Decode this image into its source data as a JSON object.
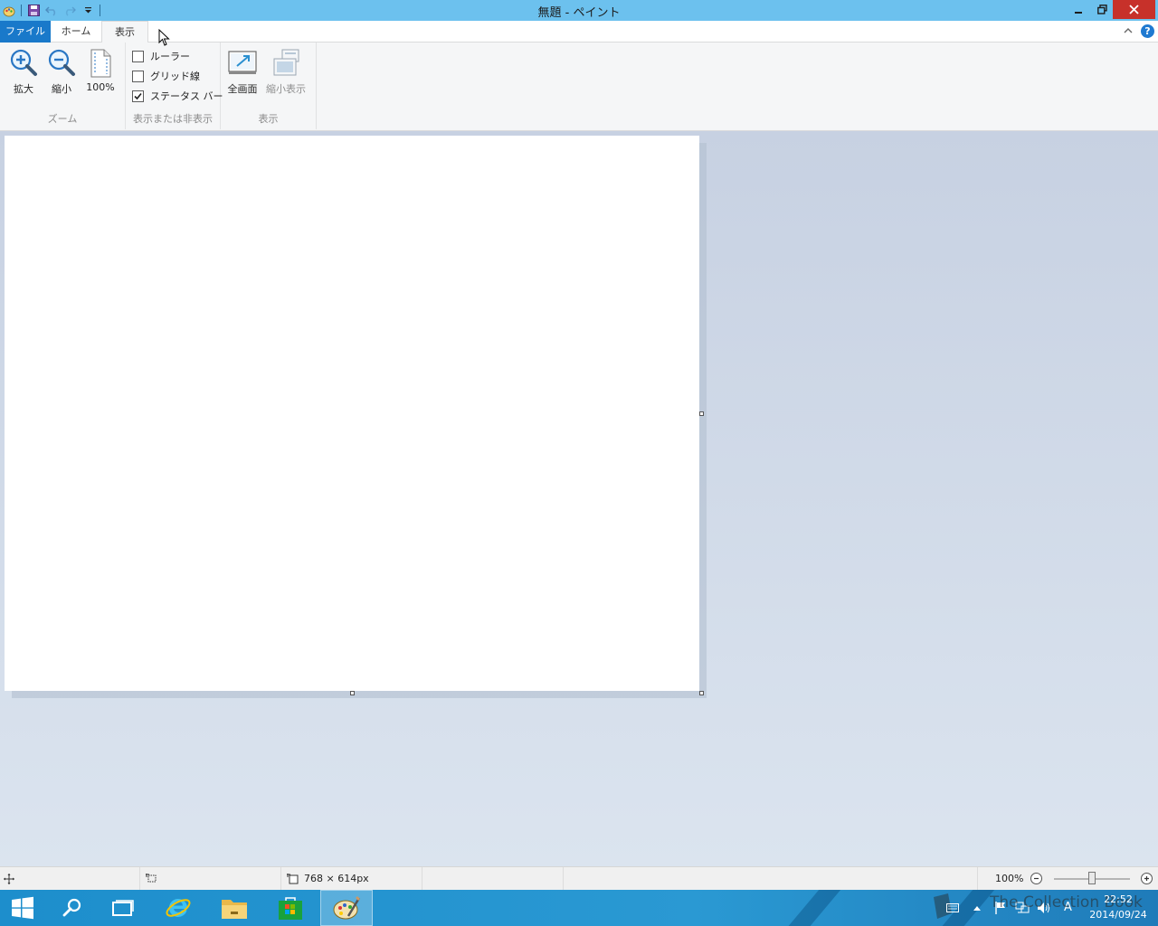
{
  "window": {
    "title": "無題 - ペイント"
  },
  "tabs": {
    "file": "ファイル",
    "home": "ホーム",
    "view": "表示"
  },
  "help": "?",
  "ribbon": {
    "zoom_group": {
      "label": "ズーム",
      "zoom_in": "拡大",
      "zoom_out": "縮小",
      "actual_size": "100%"
    },
    "show_group": {
      "label": "表示または非表示",
      "ruler": {
        "label": "ルーラー",
        "checked": false
      },
      "gridlines": {
        "label": "グリッド線",
        "checked": false
      },
      "status_bar": {
        "label": "ステータス バー",
        "checked": true
      }
    },
    "display_group": {
      "label": "表示",
      "full_screen": "全画面",
      "thumbnail": "縮小表示"
    }
  },
  "status": {
    "image_size": "768 × 614px",
    "zoom": "100%"
  },
  "taskbar": {
    "clock_time": "22:52",
    "clock_date": "2014/09/24",
    "ime": "A",
    "watermark": "The Collection Book"
  },
  "colors": {
    "titlebar": "#6cc1ee",
    "file_tab": "#1979ca",
    "close_button": "#c7312a",
    "taskbar": "#2a99d3"
  }
}
